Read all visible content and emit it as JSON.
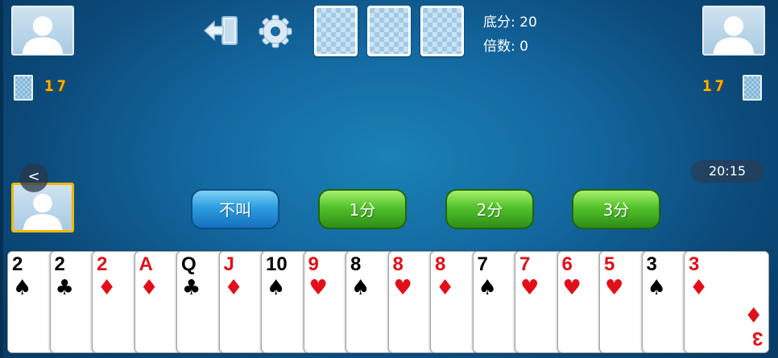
{
  "top_bar": {
    "base_label": "底分: 20",
    "multiplier_label": "倍数: 0",
    "icons": [
      "exit-icon",
      "gear-icon"
    ]
  },
  "opponents": {
    "left": {
      "avatar": "default-avatar-icon",
      "card_count": "17"
    },
    "right": {
      "avatar": "default-avatar-icon",
      "card_count": "17"
    }
  },
  "clock": "20:15",
  "back_button": "<",
  "actions": [
    {
      "label": "不叫",
      "style": "blue"
    },
    {
      "label": "1分",
      "style": "green"
    },
    {
      "label": "2分",
      "style": "green"
    },
    {
      "label": "3分",
      "style": "green"
    }
  ],
  "colors": {
    "table": "#1368a0",
    "self_highlight": "#f0b800",
    "red_suit": "#e30f18",
    "count": "#ffb400"
  },
  "hand": [
    {
      "rank": "2",
      "suit": "♠",
      "color": "black"
    },
    {
      "rank": "2",
      "suit": "♣",
      "color": "black"
    },
    {
      "rank": "2",
      "suit": "♦",
      "color": "red"
    },
    {
      "rank": "A",
      "suit": "♦",
      "color": "red"
    },
    {
      "rank": "Q",
      "suit": "♣",
      "color": "black"
    },
    {
      "rank": "J",
      "suit": "♦",
      "color": "red"
    },
    {
      "rank": "10",
      "suit": "♠",
      "color": "black"
    },
    {
      "rank": "9",
      "suit": "♥",
      "color": "red"
    },
    {
      "rank": "8",
      "suit": "♠",
      "color": "black"
    },
    {
      "rank": "8",
      "suit": "♥",
      "color": "red"
    },
    {
      "rank": "8",
      "suit": "♦",
      "color": "red"
    },
    {
      "rank": "7",
      "suit": "♠",
      "color": "black"
    },
    {
      "rank": "7",
      "suit": "♥",
      "color": "red"
    },
    {
      "rank": "6",
      "suit": "♥",
      "color": "red"
    },
    {
      "rank": "5",
      "suit": "♥",
      "color": "red"
    },
    {
      "rank": "3",
      "suit": "♠",
      "color": "black"
    },
    {
      "rank": "3",
      "suit": "♦",
      "color": "red"
    }
  ]
}
